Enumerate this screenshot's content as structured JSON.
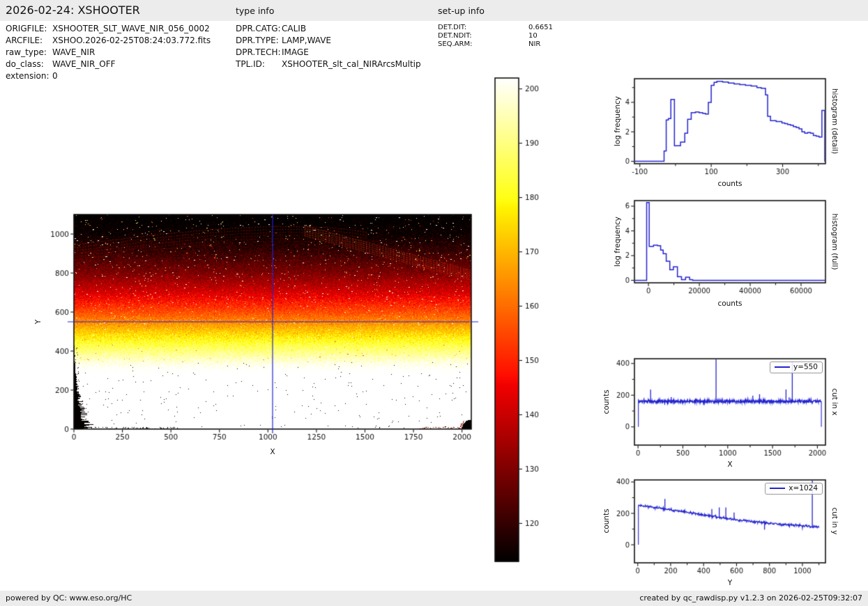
{
  "header": {
    "title": "2026-02-24: XSHOOTER",
    "type_info_label": "type info",
    "setup_info_label": "set-up info"
  },
  "file_info": {
    "rows": [
      {
        "label": "ORIGFILE:",
        "value": "XSHOOTER_SLT_WAVE_NIR_056_0002"
      },
      {
        "label": "ARCFILE:",
        "value": "XSHOO.2026-02-25T08:24:03.772.fits"
      },
      {
        "label": "raw_type:",
        "value": "WAVE_NIR"
      },
      {
        "label": "do_class:",
        "value": "WAVE_NIR_OFF"
      },
      {
        "label": "extension:",
        "value": "0"
      }
    ]
  },
  "type_info": {
    "rows": [
      {
        "label": "DPR.CATG:",
        "value": "CALIB"
      },
      {
        "label": "DPR.TYPE:",
        "value": "LAMP,WAVE"
      },
      {
        "label": "DPR.TECH:",
        "value": "IMAGE"
      },
      {
        "label": "TPL.ID:",
        "value": "XSHOOTER_slt_cal_NIRArcsMultip"
      }
    ]
  },
  "setup_info": {
    "rows": [
      {
        "label": "DET.DIT:",
        "value": "0.6651"
      },
      {
        "label": "DET.NDIT:",
        "value": "10"
      },
      {
        "label": "SEQ.ARM:",
        "value": "NIR"
      }
    ]
  },
  "footer": {
    "left": "powered by QC: www.eso.org/HC",
    "right": "created by qc_rawdisp.py v1.2.3 on 2026-02-25T09:32:07"
  },
  "colors": {
    "line_blue": "#2323cf",
    "bar_bg": "#ececec",
    "text": "#111111",
    "axes": "#111111"
  },
  "chart_data": [
    {
      "id": "raw-frame-image",
      "type": "heatmap",
      "xlabel": "X",
      "ylabel": "Y",
      "xlim": [
        0,
        2048
      ],
      "ylim": [
        0,
        1100
      ],
      "xticks": [
        0,
        250,
        500,
        750,
        1000,
        1250,
        1500,
        1750,
        2000
      ],
      "yticks": [
        0,
        200,
        400,
        600,
        800,
        1000
      ],
      "colormap": "hot",
      "vmin": 113,
      "vmax": 202,
      "crosshair": {
        "x": 1024,
        "y": 550
      },
      "row_mean_counts": {
        "Y": [
          0,
          100,
          200,
          300,
          400,
          500,
          550,
          600,
          700,
          800,
          900,
          1000,
          1100
        ],
        "counts": [
          253,
          238,
          222,
          206,
          190,
          173,
          164,
          156,
          142,
          130,
          121,
          114,
          110
        ]
      },
      "features": [
        "moire fringe arcs near top center",
        "diagonal fringe band toward upper-right edge",
        "dark vignette along lower-left edge and lower-right corner",
        "hot-pixel speckles"
      ]
    },
    {
      "id": "colorbar",
      "type": "colorbar",
      "colormap": "hot",
      "vmin": 113,
      "vmax": 202,
      "ticks": [
        120,
        130,
        140,
        150,
        160,
        170,
        180,
        190,
        200
      ]
    },
    {
      "id": "histogram-detail",
      "type": "step-histogram",
      "side_label": "histogram (detail)",
      "xlabel": "counts",
      "ylabel": "log frequency",
      "xlim": [
        -115,
        420
      ],
      "ylim": [
        -0.16,
        5.6
      ],
      "xticks": {
        "values": [
          -100,
          0,
          100,
          200,
          300,
          400
        ],
        "labels": [
          "-100",
          "",
          "100",
          "",
          "300",
          ""
        ]
      },
      "yticks": {
        "values": [
          0,
          1,
          2,
          3,
          4,
          5
        ],
        "labels": [
          "0",
          "",
          "2",
          "",
          "4",
          ""
        ]
      },
      "bin_edges": [
        -32,
        -26,
        -20,
        -13,
        -3,
        14,
        26,
        34,
        44,
        56,
        66,
        76,
        84,
        92,
        100,
        108,
        116,
        132,
        148,
        164,
        180,
        196,
        212,
        228,
        240,
        252,
        258,
        266,
        282,
        298,
        306,
        314,
        322,
        330,
        338,
        346,
        354,
        362,
        370,
        378,
        386,
        394,
        402,
        410,
        418
      ],
      "log_frequency": [
        0.7,
        2.8,
        2.9,
        4.2,
        1.05,
        1.3,
        1.9,
        2.85,
        3.3,
        3.35,
        3.3,
        3.25,
        3.2,
        4.0,
        5.15,
        5.35,
        5.42,
        5.38,
        5.3,
        5.25,
        5.2,
        5.15,
        5.1,
        5.0,
        4.95,
        4.5,
        3.05,
        2.75,
        2.7,
        2.6,
        2.55,
        2.5,
        2.45,
        2.35,
        2.3,
        2.2,
        2.0,
        1.9,
        1.95,
        1.9,
        1.75,
        1.7,
        1.65,
        3.45
      ]
    },
    {
      "id": "histogram-full",
      "type": "step-histogram",
      "side_label": "histogram (full)",
      "xlabel": "counts",
      "ylabel": "log frequency",
      "xlim": [
        -5500,
        69600
      ],
      "ylim": [
        -0.2,
        6.45
      ],
      "xticks": {
        "values": [
          0,
          10000,
          20000,
          30000,
          40000,
          50000,
          60000
        ],
        "labels": [
          "0",
          "",
          "20000",
          "",
          "40000",
          "",
          "60000"
        ]
      },
      "yticks": {
        "values": [
          0,
          1,
          2,
          3,
          4,
          5,
          6
        ],
        "labels": [
          "0",
          "",
          "2",
          "",
          "4",
          "",
          "6"
        ]
      },
      "bin_edges": [
        -700,
        300,
        2000,
        3600,
        4800,
        5800,
        7000,
        8400,
        9800,
        11400,
        13000,
        14600,
        16200,
        17400
      ],
      "log_frequency": [
        6.3,
        2.75,
        2.85,
        2.8,
        2.45,
        2.15,
        1.55,
        0.85,
        1.1,
        0.3,
        0.05,
        0.25,
        0.05
      ]
    },
    {
      "id": "cut-in-x",
      "type": "line",
      "legend": "y=550",
      "side_label": "cut in x",
      "xlabel": "X",
      "ylabel": "counts",
      "xlim": [
        -40,
        2090
      ],
      "ylim": [
        -115,
        430
      ],
      "xticks": {
        "values": [
          0,
          250,
          500,
          750,
          1000,
          1250,
          1500,
          1750,
          2000
        ],
        "labels": [
          "0",
          "",
          "500",
          "",
          "1000",
          "",
          "1500",
          "",
          "2000"
        ]
      },
      "yticks": {
        "values": [
          0,
          100,
          200,
          300,
          400
        ],
        "labels": [
          "0",
          "",
          "200",
          "",
          "400"
        ]
      },
      "baseline": {
        "x": [
          4,
          2044
        ],
        "counts": [
          161,
          161
        ]
      },
      "noise_sigma": 4.5,
      "spikes": [
        {
          "x": 140,
          "counts": 235
        },
        {
          "x": 370,
          "counts": 188
        },
        {
          "x": 640,
          "counts": 179
        },
        {
          "x": 730,
          "counts": 138
        },
        {
          "x": 870,
          "counts": 445
        },
        {
          "x": 1280,
          "counts": 197
        },
        {
          "x": 1355,
          "counts": 206
        },
        {
          "x": 1650,
          "counts": 236
        },
        {
          "x": 1685,
          "counts": 186
        },
        {
          "x": 1720,
          "counts": 412
        }
      ],
      "edges_drop_to_zero": true
    },
    {
      "id": "cut-in-y",
      "type": "line",
      "legend": "x=1024",
      "side_label": "cut in y",
      "xlabel": "Y",
      "ylabel": "counts",
      "xlim": [
        -20,
        1140
      ],
      "ylim": [
        -115,
        413
      ],
      "xticks": {
        "values": [
          0,
          100,
          200,
          300,
          400,
          500,
          600,
          700,
          800,
          900,
          1000,
          1100
        ],
        "labels": [
          "0",
          "",
          "200",
          "",
          "400",
          "",
          "600",
          "",
          "800",
          "",
          "1000",
          ""
        ]
      },
      "yticks": {
        "values": [
          0,
          100,
          200,
          300,
          400
        ],
        "labels": [
          "0",
          "",
          "200",
          "",
          "400"
        ]
      },
      "baseline": {
        "x": [
          4,
          50,
          100,
          200,
          300,
          400,
          500,
          600,
          700,
          800,
          900,
          1000,
          1100
        ],
        "counts": [
          252,
          246,
          238,
          222,
          206,
          190,
          174,
          159,
          148,
          136,
          128,
          121,
          111
        ]
      },
      "noise_sigma": 4,
      "spikes": [
        {
          "x": 165,
          "counts": 292
        },
        {
          "x": 450,
          "counts": 228
        },
        {
          "x": 495,
          "counts": 238
        },
        {
          "x": 535,
          "counts": 238
        },
        {
          "x": 585,
          "counts": 206
        },
        {
          "x": 770,
          "counts": 96
        },
        {
          "x": 1060,
          "counts": 412
        }
      ],
      "edges_drop_to_zero": false
    }
  ]
}
